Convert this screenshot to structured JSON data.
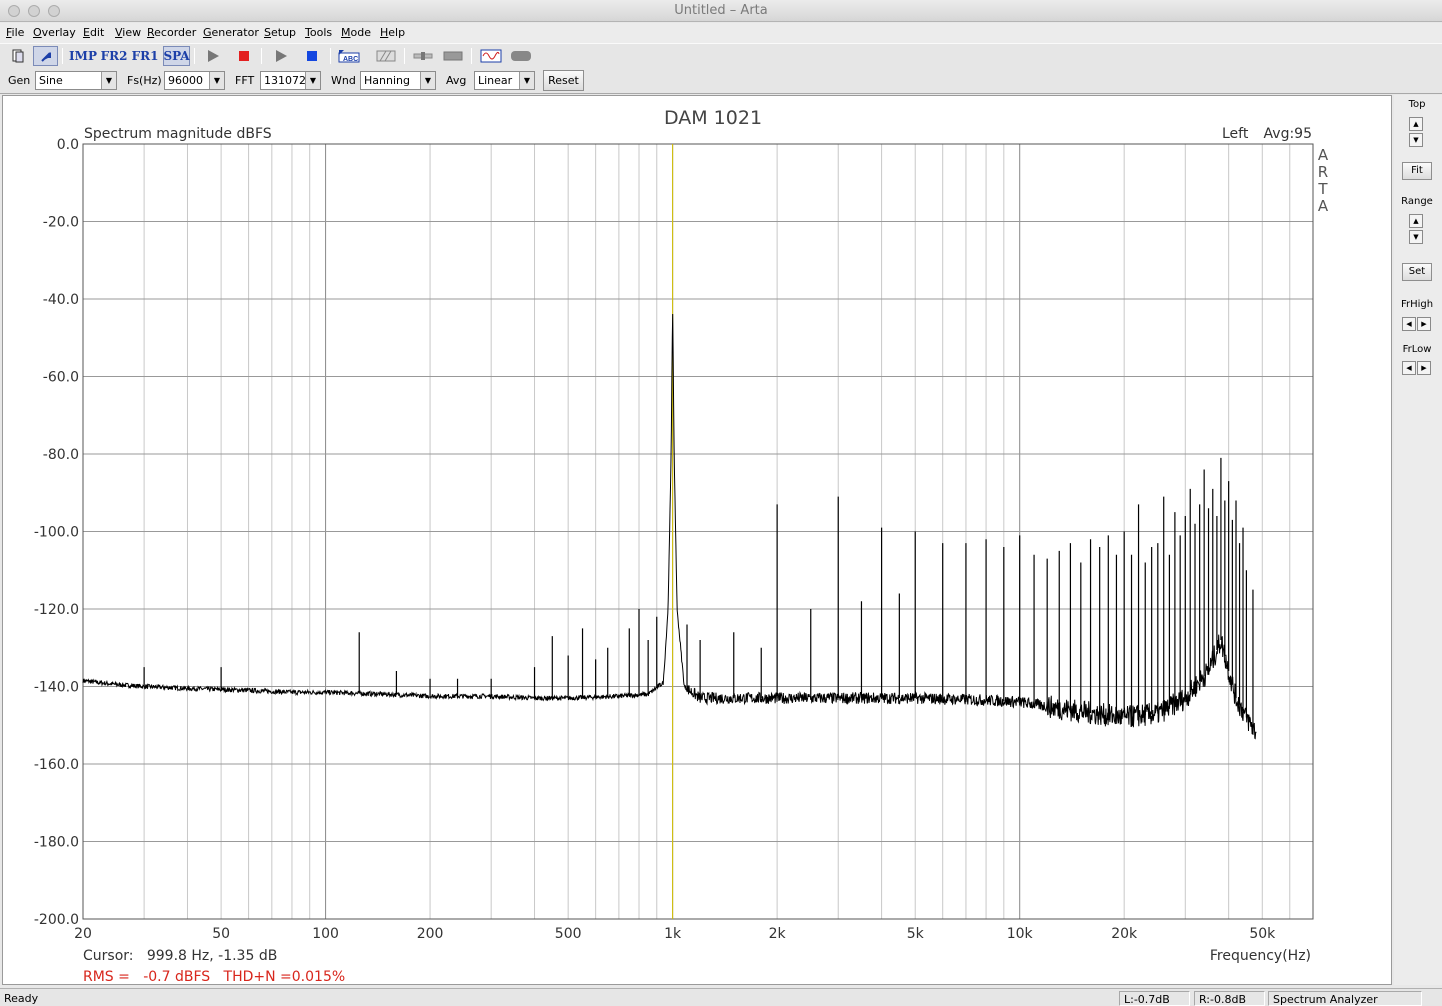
{
  "window": {
    "title": "Untitled – Arta"
  },
  "menu": [
    "File",
    "Overlay",
    "Edit",
    "View",
    "Recorder",
    "Generator",
    "Setup",
    "Tools",
    "Mode",
    "Help"
  ],
  "toolbar": {
    "imp": "IMP",
    "fr2": "FR2",
    "fr1": "FR1",
    "spa": "SPA",
    "icons": [
      "new-document-icon",
      "cursor-icon",
      "play-icon",
      "stop-red-icon",
      "play-icon",
      "stop-blue-icon",
      "abc-icon",
      "hatch-icon",
      "slider-icon",
      "gray-bar-icon",
      "sine-wave-icon",
      "rounded-gray-icon"
    ]
  },
  "settings": {
    "gen_label": "Gen",
    "gen_value": "Sine",
    "fs_label": "Fs(Hz)",
    "fs_value": "96000",
    "fft_label": "FFT",
    "fft_value": "131072",
    "wnd_label": "Wnd",
    "wnd_value": "Hanning",
    "avg_label": "Avg",
    "avg_value": "Linear",
    "reset_label": "Reset"
  },
  "chart_data": {
    "type": "line",
    "title": "DAM 1021",
    "ylabel": "Spectrum magnitude dBFS",
    "xlabel": "Frequency(Hz)",
    "channel_label": "Left",
    "avg_label": "Avg:95",
    "watermark": "ARTA",
    "x_scale": "log",
    "xlim": [
      20,
      70000
    ],
    "ylim": [
      -200,
      0
    ],
    "y_ticks": [
      "0.0",
      "-20.0",
      "-40.0",
      "-60.0",
      "-80.0",
      "-100.0",
      "-120.0",
      "-140.0",
      "-160.0",
      "-180.0",
      "-200.0"
    ],
    "x_ticks": [
      {
        "value": 20,
        "label": "20"
      },
      {
        "value": 50,
        "label": "50"
      },
      {
        "value": 100,
        "label": "100"
      },
      {
        "value": 200,
        "label": "200"
      },
      {
        "value": 500,
        "label": "500"
      },
      {
        "value": 1000,
        "label": "1k"
      },
      {
        "value": 2000,
        "label": "2k"
      },
      {
        "value": 5000,
        "label": "5k"
      },
      {
        "value": 10000,
        "label": "10k"
      },
      {
        "value": 20000,
        "label": "20k"
      },
      {
        "value": 50000,
        "label": "50k"
      }
    ],
    "grid": true,
    "cursor_frequency": 999.8,
    "series": [
      {
        "baseline": [
          [
            20,
            -138.5
          ],
          [
            25,
            -139.5
          ],
          [
            30,
            -140
          ],
          [
            40,
            -140.5
          ],
          [
            60,
            -141
          ],
          [
            80,
            -141.5
          ],
          [
            100,
            -141.5
          ],
          [
            150,
            -142
          ],
          [
            200,
            -142.5
          ],
          [
            300,
            -142.5
          ],
          [
            400,
            -143
          ],
          [
            500,
            -143
          ],
          [
            700,
            -142.5
          ],
          [
            850,
            -142
          ],
          [
            940,
            -139
          ],
          [
            970,
            -120
          ],
          [
            990,
            -80
          ],
          [
            999.8,
            -41
          ],
          [
            1010,
            -80
          ],
          [
            1030,
            -120
          ],
          [
            1080,
            -140
          ],
          [
            1200,
            -143
          ],
          [
            2000,
            -143
          ],
          [
            3000,
            -143
          ],
          [
            5000,
            -143
          ],
          [
            8000,
            -143.5
          ],
          [
            10000,
            -144
          ],
          [
            15000,
            -146.5
          ],
          [
            20000,
            -148
          ],
          [
            25000,
            -147
          ],
          [
            30000,
            -143
          ],
          [
            35000,
            -136
          ],
          [
            38000,
            -128
          ],
          [
            40000,
            -136
          ],
          [
            42000,
            -143
          ],
          [
            45000,
            -148
          ],
          [
            48000,
            -152
          ]
        ],
        "spikes": [
          [
            30,
            -135
          ],
          [
            50,
            -135
          ],
          [
            125,
            -126
          ],
          [
            160,
            -136
          ],
          [
            200,
            -138
          ],
          [
            240,
            -138
          ],
          [
            300,
            -138
          ],
          [
            400,
            -135
          ],
          [
            450,
            -127
          ],
          [
            500,
            -132
          ],
          [
            550,
            -125
          ],
          [
            600,
            -133
          ],
          [
            650,
            -130
          ],
          [
            750,
            -125
          ],
          [
            800,
            -120
          ],
          [
            850,
            -128
          ],
          [
            900,
            -122
          ],
          [
            1100,
            -124
          ],
          [
            1200,
            -128
          ],
          [
            1500,
            -126
          ],
          [
            1800,
            -130
          ],
          [
            2000,
            -93
          ],
          [
            2500,
            -120
          ],
          [
            3000,
            -91
          ],
          [
            3500,
            -118
          ],
          [
            4000,
            -99
          ],
          [
            4500,
            -116
          ],
          [
            5000,
            -100
          ],
          [
            6000,
            -103
          ],
          [
            7000,
            -103
          ],
          [
            8000,
            -102
          ],
          [
            9000,
            -104
          ],
          [
            10000,
            -101
          ],
          [
            11000,
            -106
          ],
          [
            12000,
            -107
          ],
          [
            13000,
            -105
          ],
          [
            14000,
            -103
          ],
          [
            15000,
            -108
          ],
          [
            16000,
            -102
          ],
          [
            17000,
            -104
          ],
          [
            18000,
            -101
          ],
          [
            19000,
            -106
          ],
          [
            20000,
            -100
          ],
          [
            21000,
            -106
          ],
          [
            22000,
            -93
          ],
          [
            23000,
            -108
          ],
          [
            24000,
            -104
          ],
          [
            25000,
            -103
          ],
          [
            26000,
            -91
          ],
          [
            27000,
            -106
          ],
          [
            28000,
            -95
          ],
          [
            29000,
            -101
          ],
          [
            30000,
            -96
          ],
          [
            31000,
            -89
          ],
          [
            32000,
            -98
          ],
          [
            33000,
            -93
          ],
          [
            34000,
            -84
          ],
          [
            35000,
            -94
          ],
          [
            36000,
            -89
          ],
          [
            37000,
            -96
          ],
          [
            38000,
            -81
          ],
          [
            39000,
            -92
          ],
          [
            40000,
            -87
          ],
          [
            41000,
            -97
          ],
          [
            42000,
            -92
          ],
          [
            43000,
            -103
          ],
          [
            44000,
            -99
          ],
          [
            45000,
            -110
          ],
          [
            47000,
            -115
          ]
        ]
      }
    ]
  },
  "readout": {
    "cursor": "Cursor:   999.8 Hz, -1.35 dB",
    "rms": "RMS =   -0.7 dBFS   THD+N =0.015%"
  },
  "right_panel": {
    "top": "Top",
    "fit": "Fit",
    "range": "Range",
    "set": "Set",
    "frhigh": "FrHigh",
    "frlow": "FrLow"
  },
  "status": {
    "ready": "Ready",
    "left_level": "L:-0.7dB",
    "right_level": "R:-0.8dB",
    "mode": "Spectrum Analyzer"
  }
}
